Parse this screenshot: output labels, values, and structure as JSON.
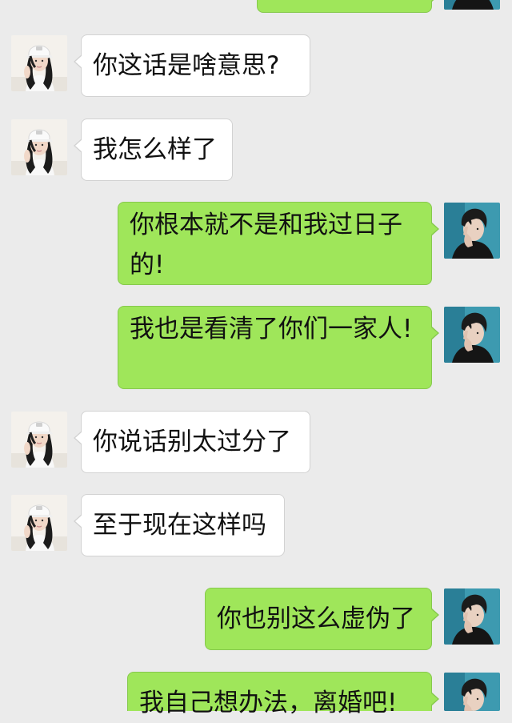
{
  "conversation": {
    "messages": [
      {
        "side": "right",
        "text": ""
      },
      {
        "side": "left",
        "text": "你这话是啥意思?"
      },
      {
        "side": "left",
        "text": "我怎么样了"
      },
      {
        "side": "right",
        "text": "你根本就不是和我过日子的!"
      },
      {
        "side": "right",
        "text": "我也是看清了你们一家人!"
      },
      {
        "side": "left",
        "text": "你说话别太过分了"
      },
      {
        "side": "left",
        "text": "至于现在这样吗"
      },
      {
        "side": "right",
        "text": "你也别这么虚伪了"
      },
      {
        "side": "right",
        "text": "我自己想办法，离婚吧!"
      }
    ]
  },
  "avatars": {
    "female": "female-user-avatar",
    "male": "male-user-avatar"
  },
  "colors": {
    "background": "#ebebeb",
    "incoming_bubble": "#ffffff",
    "outgoing_bubble": "#9fe65a"
  }
}
